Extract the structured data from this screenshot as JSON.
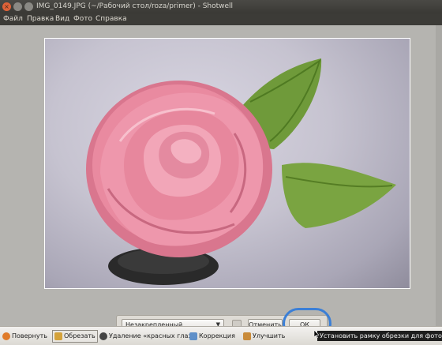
{
  "window": {
    "title": "IMG_0149.JPG (~/Рабочий стол/roza/primer) - Shotwell"
  },
  "menu": [
    "Файл",
    "Правка",
    "Вид",
    "Фото",
    "Справка"
  ],
  "crop_toolbar": {
    "constraint_value": "Незакрепленный",
    "cancel_label": "Отменить",
    "ok_label": "ОК"
  },
  "bottom_toolbar": {
    "rotate_label": "Повернуть",
    "crop_label": "Обрезать",
    "redeye_label": "Удаление «красных глаз»",
    "adjust_label": "Коррекция",
    "enhance_label": "Улучшить"
  },
  "tooltip": "Установить рамку обрезки для фото",
  "colors": {
    "highlight": "#3b7fd6",
    "rose": "#e98aa0",
    "leaf": "#6f9a3a"
  }
}
